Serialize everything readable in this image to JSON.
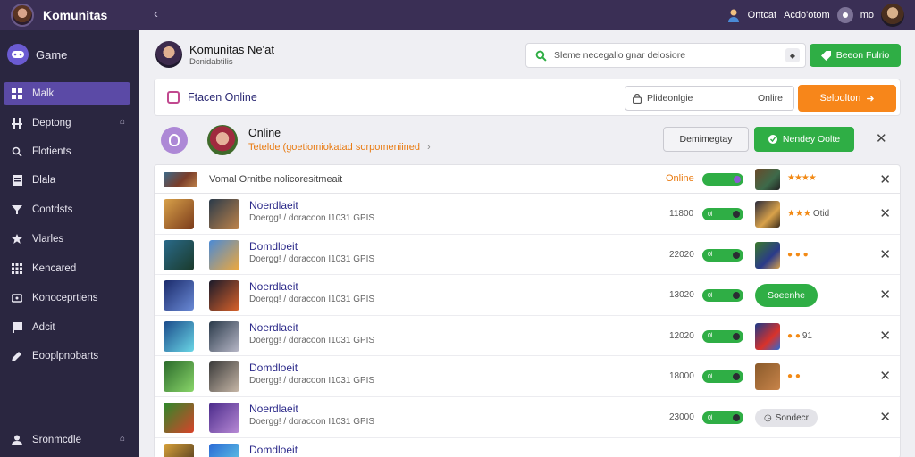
{
  "topbar": {
    "title": "Komunitas",
    "back_glyph": "‹",
    "link_1": "Ontcat",
    "link_2": "Acdo'otom",
    "user_label": "mo"
  },
  "sidebar": {
    "header": "Game",
    "items": [
      {
        "label": "Malk",
        "icon": "grid-icon",
        "active": true
      },
      {
        "label": "Deptong",
        "icon": "sliders-icon",
        "chevron": true
      },
      {
        "label": "Flotients",
        "icon": "search-icon"
      },
      {
        "label": "Dlala",
        "icon": "document-icon"
      },
      {
        "label": "Contdsts",
        "icon": "filter-icon"
      },
      {
        "label": "Vlarles",
        "icon": "star-icon"
      },
      {
        "label": "Kencared",
        "icon": "apps-icon"
      },
      {
        "label": "Konoceprtiens",
        "icon": "layers-icon"
      },
      {
        "label": "Adcit",
        "icon": "flag-icon"
      },
      {
        "label": "Eooplpnobarts",
        "icon": "pen-icon"
      }
    ],
    "footer": {
      "label": "Sronmcdle",
      "icon": "user-icon"
    }
  },
  "profile": {
    "name": "Komunitas Ne'at",
    "subtitle": "Dcnidabtilis"
  },
  "search": {
    "placeholder": "Sleme necegalio gnar delosiore",
    "select_glyph": "◆"
  },
  "top_button": "Beeon Fulrio",
  "room": {
    "title": "Ftacen Online",
    "input_placeholder": "Plideonlgie",
    "input_value": "Onlire",
    "action": "Seloolton"
  },
  "online": {
    "title": "Online",
    "subtitle": "Tetelde (goetiomiokatad sorpomeniined",
    "arrow": "›",
    "outline_button": "Demimegtay",
    "green_button": "Nendey Oolte"
  },
  "list": {
    "header": {
      "text": "Vomal Ornitbe nolicoresitmeait",
      "status": "Online",
      "stars": "★★★★"
    },
    "rows": [
      {
        "title": "Noerdlaeit",
        "sub": "Doergg! / doracoon I1031 GPIS",
        "num": "11800",
        "pill": "0l",
        "stars": "★★★",
        "rating": "Otid",
        "mode": "stars",
        "t1": "linear-gradient(135deg,#d9a24a,#7a3a1a)",
        "t2": "linear-gradient(135deg,#2a3a4a,#c0844a)",
        "av": "linear-gradient(135deg,#2a2a3a,#d9a24a 60%,#3a2a1a)"
      },
      {
        "title": "Domdloeit",
        "sub": "Doergg! / doracoon I1031 GPIS",
        "num": "22020",
        "pill": "0l",
        "stars": "● ● ●",
        "rating": "",
        "mode": "stars",
        "t1": "linear-gradient(135deg,#2a6a8a,#1a3a2a)",
        "t2": "linear-gradient(135deg,#4a8ad6,#f0a83a)",
        "av": "linear-gradient(135deg,#3a7a2a,#2a3a8a 60%,#d9a24a)"
      },
      {
        "title": "Noerdlaeit",
        "sub": "Doergg! / doracoon I1031 GPIS",
        "num": "13020",
        "pill": "0l",
        "stars": "",
        "rating": "",
        "mode": "green",
        "btn": "Soeenhe",
        "t1": "linear-gradient(135deg,#1a2a6a,#6a8ad6)",
        "t2": "linear-gradient(135deg,#1a1a2a,#d9622a)",
        "av": ""
      },
      {
        "title": "Noerdlaeit",
        "sub": "Doergg! / doracoon I1031 GPIS",
        "num": "12020",
        "pill": "0l",
        "stars": "● ●",
        "rating": "91",
        "mode": "stars",
        "t1": "linear-gradient(135deg,#1a4a8a,#6ad6e6)",
        "t2": "linear-gradient(135deg,#2a3a4a,#b8b8c8)",
        "av": "linear-gradient(135deg,#1a3a8a,#d9322a 60%,#2a6ad6)"
      },
      {
        "title": "Domdloeit",
        "sub": "Doergg! / doracoon I1031 GPIS",
        "num": "18000",
        "pill": "0l",
        "stars": "● ●",
        "rating": "",
        "mode": "stars",
        "t1": "linear-gradient(135deg,#2a6a2a,#8ad66a)",
        "t2": "linear-gradient(135deg,#3a3a3a,#c8b8a8)",
        "av": "linear-gradient(135deg,#8a5a2a,#c8844a)"
      },
      {
        "title": "Noerdlaeit",
        "sub": "Doergg! / doracoon I1031 GPIS",
        "num": "23000",
        "pill": "0l",
        "stars": "",
        "rating": "",
        "mode": "grey",
        "btn": "Sondecr",
        "t1": "linear-gradient(135deg,#2a8a2a,#d9422a)",
        "t2": "linear-gradient(135deg,#4a2a8a,#b88ad6)",
        "av": ""
      },
      {
        "title": "Domdloeit",
        "sub": "",
        "num": "",
        "pill": "",
        "stars": "",
        "rating": "",
        "mode": "none",
        "t1": "linear-gradient(135deg,#d9a23a,#3a2a1a)",
        "t2": "linear-gradient(135deg,#2a6ad6,#6ad6e6)",
        "av": ""
      }
    ]
  },
  "close_glyph": "✕"
}
